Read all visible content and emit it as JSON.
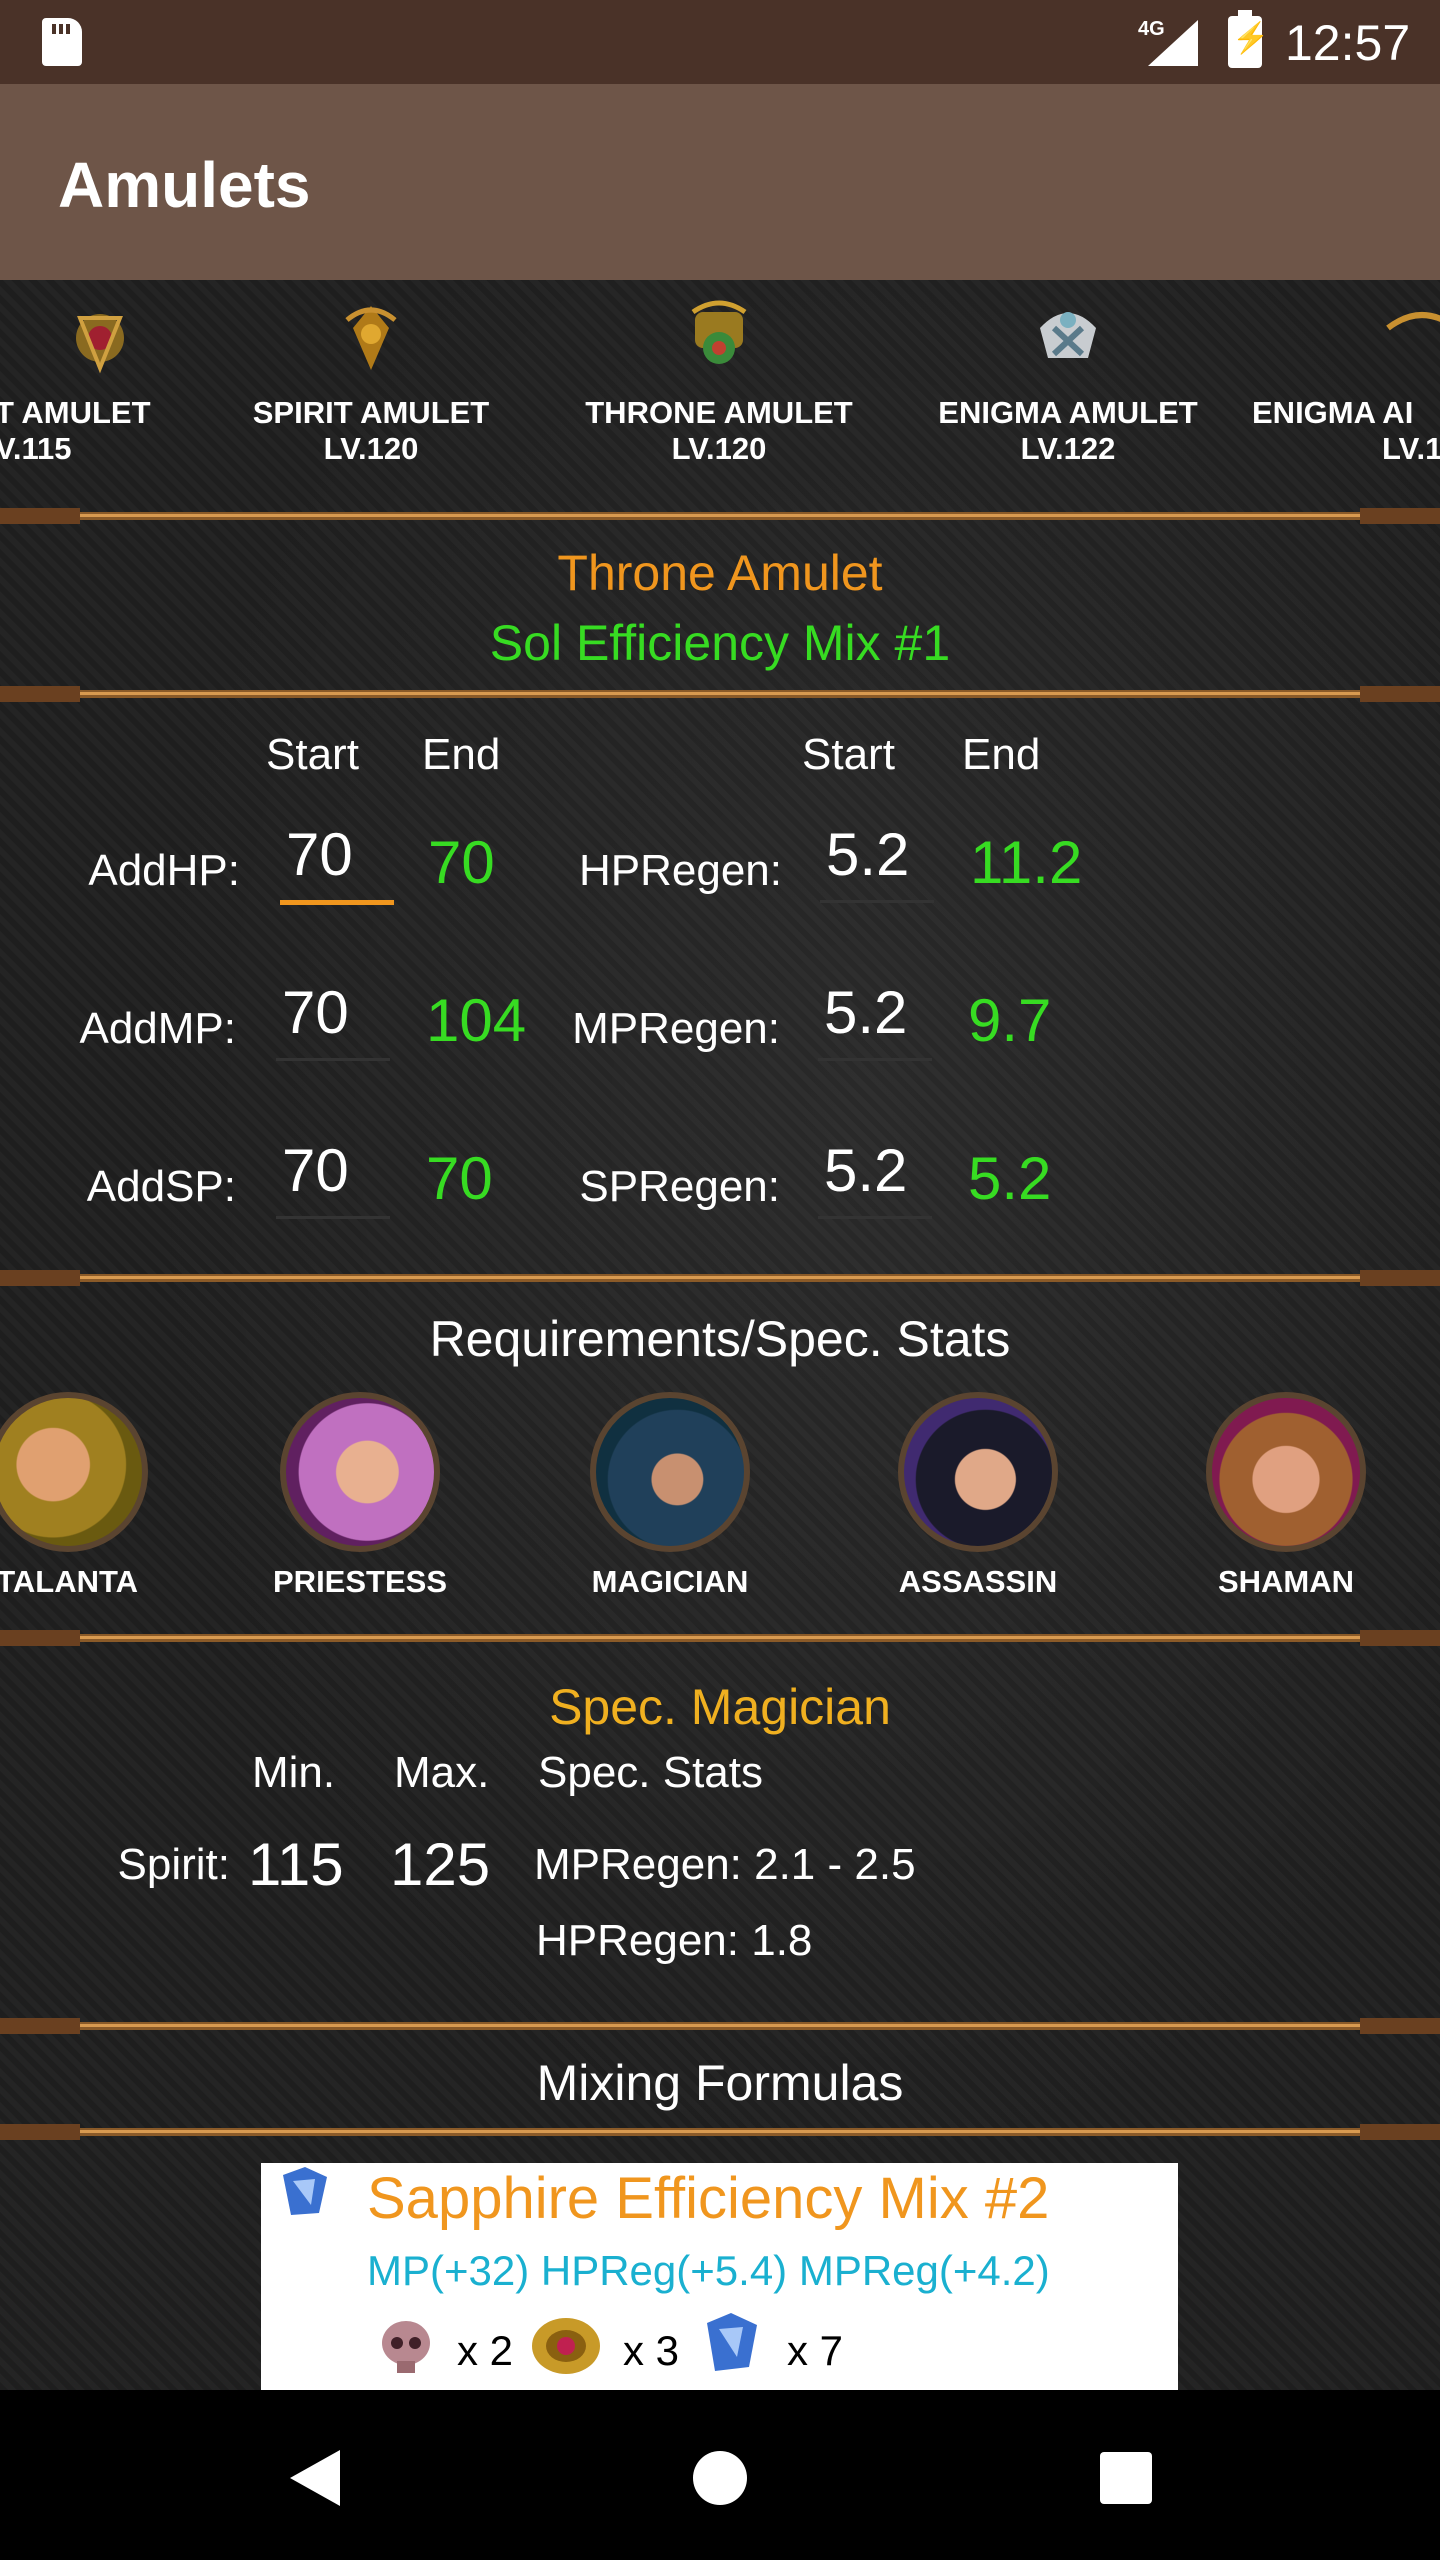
{
  "status": {
    "network": "4G",
    "time": "12:57"
  },
  "appbar": {
    "title": "Amulets"
  },
  "amulets": [
    {
      "name": "T AMULET",
      "level": "V.115"
    },
    {
      "name": "SPIRIT AMULET",
      "level": "LV.120"
    },
    {
      "name": "THRONE AMULET",
      "level": "LV.120"
    },
    {
      "name": "ENIGMA AMULET",
      "level": "LV.122"
    },
    {
      "name": "ENIGMA AI",
      "level": "LV.1"
    }
  ],
  "item": {
    "name": "Throne Amulet",
    "mix": "Sol Efficiency Mix #1"
  },
  "stats": {
    "start_label": "Start",
    "end_label": "End",
    "left": [
      {
        "label": "AddHP:",
        "start": "70",
        "end": "70"
      },
      {
        "label": "AddMP:",
        "start": "70",
        "end": "104"
      },
      {
        "label": "AddSP:",
        "start": "70",
        "end": "70"
      }
    ],
    "right": [
      {
        "label": "HPRegen:",
        "start": "5.2",
        "end": "11.2"
      },
      {
        "label": "MPRegen:",
        "start": "5.2",
        "end": "9.7"
      },
      {
        "label": "SPRegen:",
        "start": "5.2",
        "end": "5.2"
      }
    ]
  },
  "requirements": {
    "title": "Requirements/Spec. Stats",
    "classes": [
      "TALANTA",
      "PRIESTESS",
      "MAGICIAN",
      "ASSASSIN",
      "SHAMAN"
    ]
  },
  "spec": {
    "title": "Spec. Magician",
    "min_label": "Min.",
    "max_label": "Max.",
    "stats_label": "Spec. Stats",
    "row_label": "Spirit:",
    "min": "115",
    "max": "125",
    "spec_stats": [
      "MPRegen: 2.1 - 2.5",
      "HPRegen: 1.8"
    ]
  },
  "formulas": {
    "title": "Mixing Formulas",
    "name": "Sapphire Efficiency Mix #2",
    "bonus": "MP(+32) HPReg(+5.4) MPReg(+4.2)",
    "ingredients": [
      {
        "icon": "skull-icon",
        "qty": "x 2"
      },
      {
        "icon": "gold-gem-icon",
        "qty": "x 3"
      },
      {
        "icon": "blue-crystal-icon",
        "qty": "x 7"
      }
    ]
  },
  "colors": {
    "statusbar": "#4a3228",
    "appbar": "#6e5548",
    "accent": "#f0961e",
    "green": "#37dc22"
  }
}
